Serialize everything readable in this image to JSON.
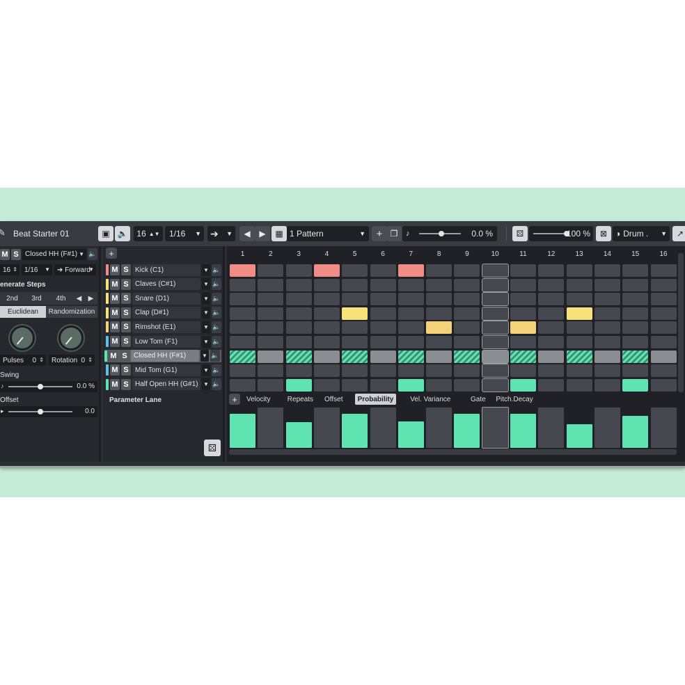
{
  "window": {
    "title": "Beat Starter 01"
  },
  "colors": {
    "band": "#c4ebd6",
    "panel": "#25282d",
    "cell_off": "#45484e",
    "red": "#f08c86",
    "yellow": "#f7e27a",
    "amber": "#f5d27a",
    "teal": "#5fe3b0",
    "gray_on": "#8a8d91"
  },
  "toolbar": {
    "steps_value": "16",
    "resolution": "1/16",
    "pattern": "1 Pattern",
    "swing_readout": "0.0 %",
    "zoom_readout": "100 %",
    "kit": "Drum ."
  },
  "left": {
    "lane_select": "Closed HH (F#1)",
    "steps": "16",
    "resolution": "1/16",
    "direction": "Forward",
    "generate_title": "enerate Steps",
    "gen_buttons": [
      "2nd",
      "3rd",
      "4th"
    ],
    "mode_tabs": [
      "Euclidean",
      "Randomization"
    ],
    "pulses_label": "Pulses",
    "pulses_value": "0",
    "rotation_label": "Rotation",
    "rotation_value": "0",
    "swing_label": "Swing",
    "swing_value": "0.0 %",
    "swing_level": 0.5,
    "offset_label": "Offset",
    "offset_value": "0.0",
    "offset_level": 0.5
  },
  "lanes": [
    {
      "name": "Kick (C1)",
      "color": "#f08c86"
    },
    {
      "name": "Claves (C#1)",
      "color": "#f7e27a"
    },
    {
      "name": "Snare (D1)",
      "color": "#f7e27a"
    },
    {
      "name": "Clap (D#1)",
      "color": "#f7e27a"
    },
    {
      "name": "Rimshot (E1)",
      "color": "#f5d27a"
    },
    {
      "name": "Low Tom (F1)",
      "color": "#5fbfe3"
    },
    {
      "name": "Closed HH (F#1)",
      "color": "#5fe3b0"
    },
    {
      "name": "Mid Tom (G1)",
      "color": "#5fbfe3"
    },
    {
      "name": "Half Open HH (G#1)",
      "color": "#5fe3b0"
    }
  ],
  "ms": {
    "m": "M",
    "s": "S"
  },
  "parameter_lane_label": "Parameter Lane",
  "steps_header": [
    "1",
    "2",
    "3",
    "4",
    "5",
    "6",
    "7",
    "8",
    "9",
    "10",
    "11",
    "12",
    "13",
    "14",
    "15",
    "16"
  ],
  "pattern_grid": [
    [
      1,
      0,
      0,
      1,
      0,
      0,
      1,
      0,
      0,
      0,
      0,
      0,
      0,
      0,
      0,
      0
    ],
    [
      0,
      0,
      0,
      0,
      0,
      0,
      0,
      0,
      0,
      0,
      0,
      0,
      0,
      0,
      0,
      0
    ],
    [
      0,
      0,
      0,
      0,
      0,
      0,
      0,
      0,
      0,
      0,
      0,
      0,
      0,
      0,
      0,
      0
    ],
    [
      0,
      0,
      0,
      0,
      1,
      0,
      0,
      0,
      0,
      0,
      0,
      0,
      1,
      0,
      0,
      0
    ],
    [
      0,
      0,
      0,
      0,
      0,
      0,
      0,
      1,
      0,
      0,
      1,
      0,
      0,
      0,
      0,
      0
    ],
    [
      0,
      0,
      0,
      0,
      0,
      0,
      0,
      0,
      0,
      0,
      0,
      0,
      0,
      0,
      0,
      0
    ],
    [
      2,
      3,
      2,
      3,
      2,
      3,
      2,
      3,
      2,
      3,
      2,
      3,
      2,
      3,
      2,
      3
    ],
    [
      0,
      0,
      0,
      0,
      0,
      0,
      0,
      0,
      0,
      0,
      0,
      0,
      0,
      0,
      0,
      0
    ],
    [
      0,
      0,
      1,
      0,
      0,
      0,
      1,
      0,
      0,
      0,
      1,
      0,
      0,
      0,
      1,
      0
    ]
  ],
  "param_tabs": [
    "Velocity",
    "Repeats",
    "Offset",
    "Probability",
    "Vel. Variance",
    "Gate",
    "Pitch.Decay"
  ],
  "active_param_tab": "Probability",
  "probability_values": [
    85,
    100,
    64,
    100,
    85,
    100,
    66,
    100,
    85,
    100,
    85,
    100,
    58,
    100,
    80,
    100
  ],
  "probability_active": [
    true,
    false,
    true,
    false,
    true,
    false,
    true,
    false,
    true,
    false,
    true,
    false,
    true,
    false,
    true,
    false
  ]
}
